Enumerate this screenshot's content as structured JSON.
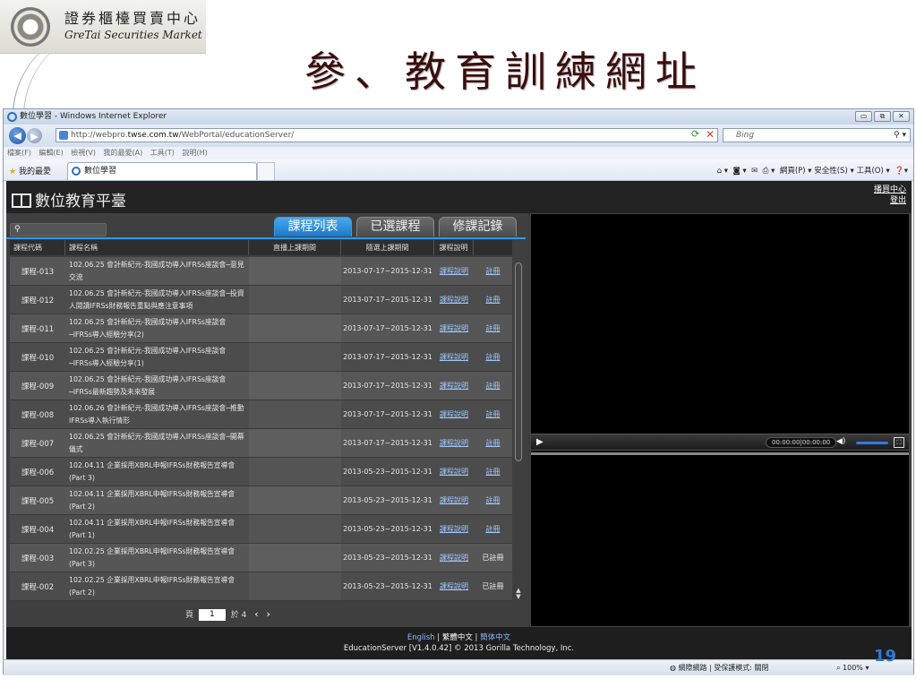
{
  "slide": {
    "title": "參、教育訓練網址",
    "logo_zh": "證券櫃檯買賣中心",
    "logo_en": "GreTai Securities Market",
    "page_number": "19"
  },
  "browser": {
    "window_title": "數位學習 - Windows Internet Explorer",
    "address_prefix": "http://webpro.",
    "address_domain": "twse.com.tw",
    "address_path": "/WebPortal/educationServer/",
    "search_placeholder": "Bing",
    "menu": [
      "檔案(F)",
      "編輯(E)",
      "檢視(V)",
      "我的最愛(A)",
      "工具(T)",
      "說明(H)"
    ],
    "favorites_label": "我的最愛",
    "tab_title": "數位學習",
    "command_bar": "網頁(P) ▾   安全性(S) ▾   工具(O) ▾",
    "status_zone": "網際網路 | 受保護模式: 關閉",
    "zoom": "100%"
  },
  "site": {
    "logo_text": "數位教育平臺",
    "links": [
      "播買中心",
      "登出"
    ],
    "tabs": [
      {
        "label": "課程列表",
        "active": true
      },
      {
        "label": "已選課程",
        "active": false
      },
      {
        "label": "修課記錄",
        "active": false
      }
    ],
    "columns": [
      "課程代碼",
      "課程名稱",
      "直播上課期間",
      "隨選上課期間",
      "課程說明",
      ""
    ],
    "rows": [
      {
        "code": "課程-013",
        "name": "102.06.25 會計新紀元-我國成功導入IFRSs座談會─意見交流",
        "live": "",
        "period": "2013-07-17~2015-12-31",
        "desc": "課程說明",
        "action": "註冊",
        "action_link": true
      },
      {
        "code": "課程-012",
        "name": "102.06.25 會計新紀元-我國成功導入IFRSs座談會─投資人閱讀IFRSs財務報告重點與應注意事項",
        "live": "",
        "period": "2013-07-17~2015-12-31",
        "desc": "課程說明",
        "action": "註冊",
        "action_link": true
      },
      {
        "code": "課程-011",
        "name": "102.06.25 會計新紀元-我國成功導入IFRSs座談會─IFRSs導入經驗分享(2)",
        "live": "",
        "period": "2013-07-17~2015-12-31",
        "desc": "課程說明",
        "action": "註冊",
        "action_link": true
      },
      {
        "code": "課程-010",
        "name": "102.06.25 會計新紀元-我國成功導入IFRSs座談會─IFRSs導入經驗分享(1)",
        "live": "",
        "period": "2013-07-17~2015-12-31",
        "desc": "課程說明",
        "action": "註冊",
        "action_link": true
      },
      {
        "code": "課程-009",
        "name": "102.06.25 會計新紀元-我國成功導入IFRSs座談會─IFRSs最新趨勢及未來發展",
        "live": "",
        "period": "2013-07-17~2015-12-31",
        "desc": "課程說明",
        "action": "註冊",
        "action_link": true
      },
      {
        "code": "課程-008",
        "name": "102.06.26 會計新紀元-我國成功導入IFRSs座談會─推動IFRSs導入執行情形",
        "live": "",
        "period": "2013-07-17~2015-12-31",
        "desc": "課程說明",
        "action": "註冊",
        "action_link": true
      },
      {
        "code": "課程-007",
        "name": "102.06.25 會計新紀元-我國成功導入IFRSs座談會─開幕儀式",
        "live": "",
        "period": "2013-07-17~2015-12-31",
        "desc": "課程說明",
        "action": "註冊",
        "action_link": true
      },
      {
        "code": "課程-006",
        "name": "102.04.11 企業採用XBRL申報IFRSs財務報告宣導會(Part 3)",
        "live": "",
        "period": "2013-05-23~2015-12-31",
        "desc": "課程說明",
        "action": "註冊",
        "action_link": true
      },
      {
        "code": "課程-005",
        "name": "102.04.11 企業採用XBRL申報IFRSs財務報告宣導會(Part 2)",
        "live": "",
        "period": "2013-05-23~2015-12-31",
        "desc": "課程說明",
        "action": "註冊",
        "action_link": true
      },
      {
        "code": "課程-004",
        "name": "102.04.11 企業採用XBRL申報IFRSs財務報告宣導會(Part 1)",
        "live": "",
        "period": "2013-05-23~2015-12-31",
        "desc": "課程說明",
        "action": "註冊",
        "action_link": true
      },
      {
        "code": "課程-003",
        "name": "102.02.25 企業採用XBRL申報IFRSs財務報告宣導會(Part 3)",
        "live": "",
        "period": "2013-05-23~2015-12-31",
        "desc": "課程說明",
        "action": "已註冊",
        "action_link": false
      },
      {
        "code": "課程-002",
        "name": "102.02.25 企業採用XBRL申報IFRSs財務報告宣導會(Part 2)",
        "live": "",
        "period": "2013-05-23~2015-12-31",
        "desc": "課程說明",
        "action": "已註冊",
        "action_link": false
      }
    ],
    "pager": {
      "prefix": "頁",
      "current": "1",
      "total_text": "於 4",
      "prev": "‹",
      "next": "›"
    },
    "player": {
      "time": "00:00:00|00:00:00"
    },
    "footer": {
      "lang_en": "English",
      "lang_tc": "繁體中文",
      "lang_sc": "簡体中文",
      "credit": "EducationServer [V1.4.0.42] © 2013 Gorilla Technology, Inc."
    }
  },
  "colors": {
    "active_tab": "#1a78c8",
    "link": "#9ec8ff",
    "slide_number": "#2d7ad6"
  }
}
